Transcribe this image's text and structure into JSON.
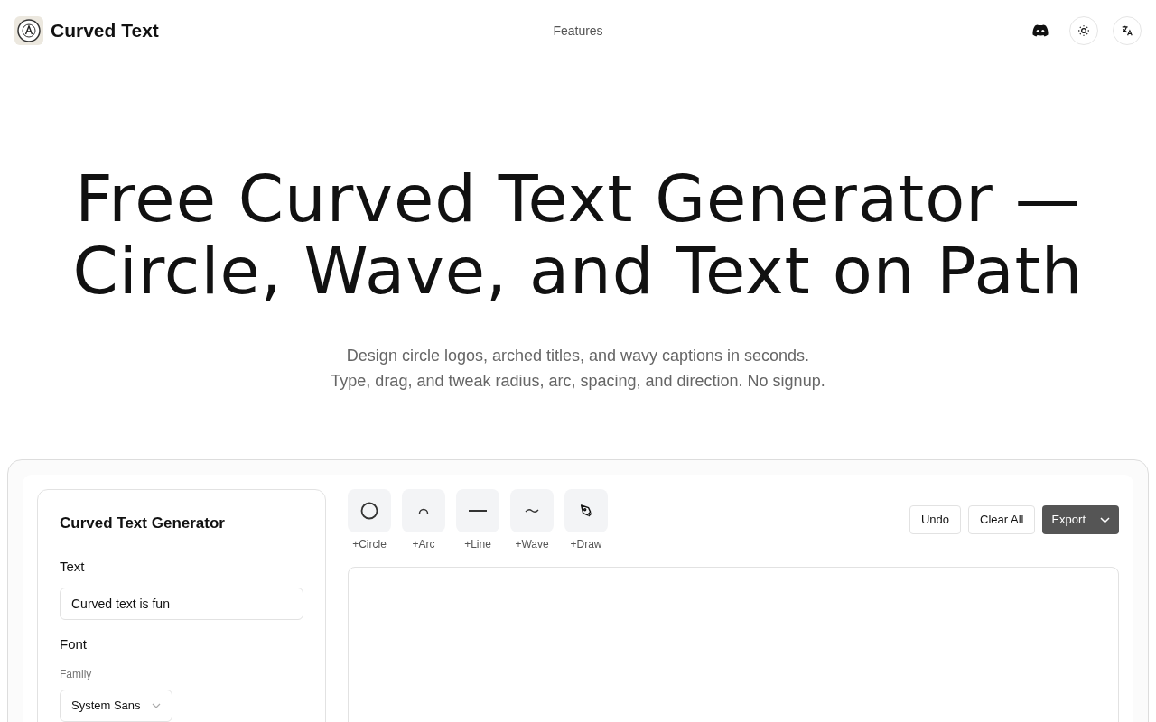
{
  "header": {
    "brand": "Curved Text",
    "nav": [
      "Features"
    ]
  },
  "hero": {
    "title_lines": [
      "Free Curved Text Generator —",
      "Circle, Wave, and Text on Path"
    ],
    "subtitle_lines": [
      "Design circle logos, arched titles, and wavy captions in seconds.",
      "Type, drag, and tweak radius, arc, spacing, and direction. No signup."
    ]
  },
  "panel": {
    "title": "Curved Text Generator",
    "text_label": "Text",
    "text_value": "Curved text is fun",
    "font_label": "Font",
    "family_label": "Family",
    "family_value": "System Sans"
  },
  "tools": [
    {
      "kind": "circle",
      "label": "+Circle"
    },
    {
      "kind": "arc",
      "label": "+Arc"
    },
    {
      "kind": "line",
      "label": "+Line"
    },
    {
      "kind": "wave",
      "label": "+Wave"
    },
    {
      "kind": "draw",
      "label": "+Draw"
    }
  ],
  "actions": [
    {
      "kind": "plain",
      "label": "Undo"
    },
    {
      "kind": "plain",
      "label": "Clear All"
    },
    {
      "kind": "menu",
      "label": "Export"
    }
  ]
}
